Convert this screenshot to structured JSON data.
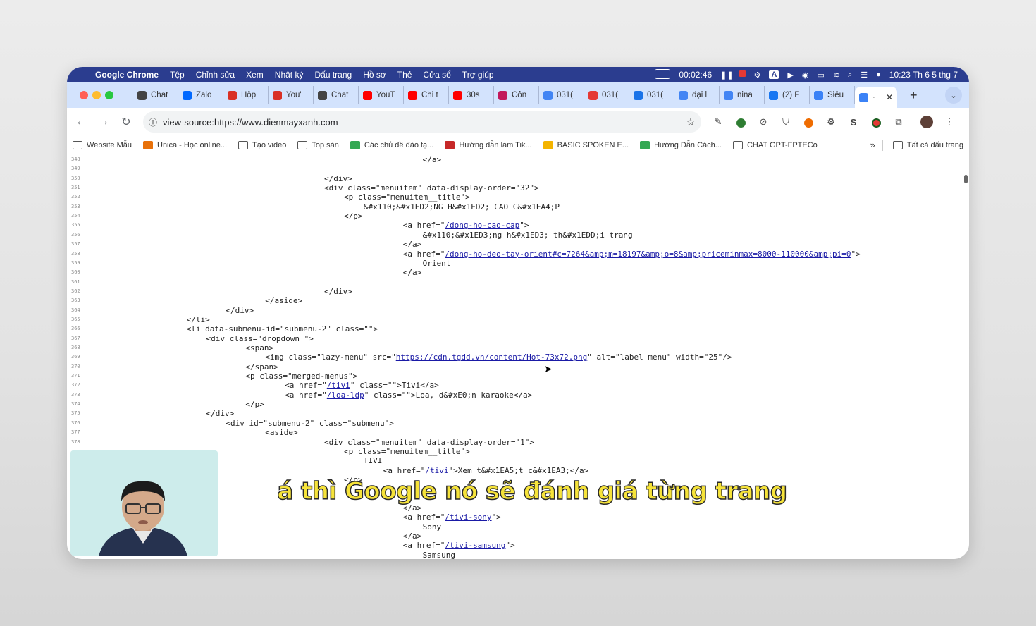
{
  "menubar": {
    "app_name": "Google Chrome",
    "menus": [
      "Tệp",
      "Chỉnh sửa",
      "Xem",
      "Nhật ký",
      "Dấu trang",
      "Hồ sơ",
      "Thẻ",
      "Cửa sổ",
      "Trợ giúp"
    ],
    "timer": "00:02:46",
    "datetime": "10:23 Th 6 5 thg 7",
    "input_source": "A"
  },
  "tabs": [
    {
      "label": "Chat",
      "icon": "chatgpt-icon",
      "color": "#444"
    },
    {
      "label": "Zalo",
      "icon": "zalo-icon",
      "color": "#0068ff"
    },
    {
      "label": "Hộp",
      "icon": "gmail-icon",
      "color": "#d93025"
    },
    {
      "label": "You'",
      "icon": "gmail-icon",
      "color": "#d93025"
    },
    {
      "label": "Chat",
      "icon": "chatgpt-icon",
      "color": "#444"
    },
    {
      "label": "YouT",
      "icon": "youtube-icon",
      "color": "#ff0000"
    },
    {
      "label": "Chi t",
      "icon": "youtube-icon",
      "color": "#ff0000"
    },
    {
      "label": "30s",
      "icon": "youtube-icon",
      "color": "#ff0000"
    },
    {
      "label": "Côn",
      "icon": "analytics-icon",
      "color": "#c2185b"
    },
    {
      "label": "031(",
      "icon": "google-icon",
      "color": "#4285f4"
    },
    {
      "label": "031(",
      "icon": "ads-icon",
      "color": "#e53935"
    },
    {
      "label": "031(",
      "icon": "sheets-icon",
      "color": "#1a73e8"
    },
    {
      "label": "đại l",
      "icon": "google-icon",
      "color": "#4285f4"
    },
    {
      "label": "nina",
      "icon": "google-icon",
      "color": "#4285f4"
    },
    {
      "label": "(2) F",
      "icon": "facebook-icon",
      "color": "#1877f2"
    },
    {
      "label": "Siêu",
      "icon": "extension-icon",
      "color": "#3b82f6"
    },
    {
      "label": "·",
      "icon": "extension-icon",
      "color": "#3b82f6",
      "active": true
    }
  ],
  "toolbar": {
    "url": "view-source:https://www.dienmayxanh.com"
  },
  "bookmarks": [
    {
      "label": "Website Mẫu",
      "icon": "folder-icon"
    },
    {
      "label": "Unica - Học online...",
      "icon": "unica-icon",
      "color": "#e8710a"
    },
    {
      "label": "Tạo video",
      "icon": "folder-icon"
    },
    {
      "label": "Top sàn",
      "icon": "folder-icon"
    },
    {
      "label": "Các chủ đề đào tạ...",
      "icon": "plus-icon",
      "color": "#34a853"
    },
    {
      "label": "Hướng dẫn làm Tik...",
      "icon": "m-icon",
      "color": "#c62828"
    },
    {
      "label": "BASIC SPOKEN E...",
      "icon": "slides-icon",
      "color": "#f4b400"
    },
    {
      "label": "Hướng Dẫn Cách...",
      "icon": "globe-icon",
      "color": "#34a853"
    },
    {
      "label": "CHAT GPT-FPTECo",
      "icon": "folder-icon"
    }
  ],
  "bookmarks_all": "Tất cả dấu trang",
  "source_lines": [
    {
      "n": "348",
      "indent": 68,
      "text": "</a>"
    },
    {
      "n": "349",
      "indent": 0,
      "text": ""
    },
    {
      "n": "350",
      "indent": 48,
      "text": "</div>"
    },
    {
      "n": "351",
      "indent": 48,
      "text": "<div class=\"menuitem\" data-display-order=\"32\">"
    },
    {
      "n": "352",
      "indent": 52,
      "text": "<p class=\"menuitem__title\">"
    },
    {
      "n": "353",
      "indent": 56,
      "text": "&#x110;&#x1ED2;NG H&#x1ED2; CAO C&#x1EA4;P"
    },
    {
      "n": "354",
      "indent": 52,
      "text": "</p>"
    },
    {
      "n": "355",
      "indent": 64,
      "pre": "<a href=\"",
      "link": "/dong-ho-cao-cap",
      "post": "\">"
    },
    {
      "n": "356",
      "indent": 68,
      "text": "&#x110;&#x1ED3;ng h&#x1ED3; th&#x1EDD;i trang"
    },
    {
      "n": "357",
      "indent": 64,
      "text": "</a>"
    },
    {
      "n": "358",
      "indent": 64,
      "pre": "<a href=\"",
      "link": "/dong-ho-deo-tay-orient#c=7264&amp;m=18197&amp;o=8&amp;priceminmax=8000-110000&amp;pi=0",
      "post": "\">"
    },
    {
      "n": "359",
      "indent": 68,
      "text": "Orient"
    },
    {
      "n": "360",
      "indent": 64,
      "text": "</a>"
    },
    {
      "n": "361",
      "indent": 0,
      "text": ""
    },
    {
      "n": "362",
      "indent": 48,
      "text": "</div>"
    },
    {
      "n": "363",
      "indent": 36,
      "text": "</aside>"
    },
    {
      "n": "364",
      "indent": 28,
      "text": "</div>"
    },
    {
      "n": "365",
      "indent": 20,
      "text": "</li>"
    },
    {
      "n": "366",
      "indent": 20,
      "text": "<li data-submenu-id=\"submenu-2\" class=\"\">"
    },
    {
      "n": "367",
      "indent": 24,
      "text": "<div class=\"dropdown \">"
    },
    {
      "n": "368",
      "indent": 32,
      "text": "<span>"
    },
    {
      "n": "369",
      "indent": 36,
      "pre": "<img class=\"lazy-menu\" src=\"",
      "link": "https://cdn.tgdd.vn/content/Hot-73x72.png",
      "post": "\" alt=\"label menu\" width=\"25\"/>"
    },
    {
      "n": "370",
      "indent": 32,
      "text": "</span>"
    },
    {
      "n": "371",
      "indent": 32,
      "text": "<p class=\"merged-menus\">"
    },
    {
      "n": "372",
      "indent": 40,
      "pre": "<a href=\"",
      "link": "/tivi",
      "post": "\" class=\"\">Tivi</a>"
    },
    {
      "n": "373",
      "indent": 40,
      "pre": "<a href=\"",
      "link": "/loa-ldp",
      "post": "\" class=\"\">Loa, d&#xE0;n karaoke</a>"
    },
    {
      "n": "374",
      "indent": 32,
      "text": "</p>"
    },
    {
      "n": "375",
      "indent": 24,
      "text": "</div>"
    },
    {
      "n": "376",
      "indent": 28,
      "text": "<div id=\"submenu-2\" class=\"submenu\">"
    },
    {
      "n": "377",
      "indent": 36,
      "text": "<aside>"
    },
    {
      "n": "378",
      "indent": 48,
      "text": "<div class=\"menuitem\" data-display-order=\"1\">"
    },
    {
      "n": "",
      "indent": 52,
      "text": "<p class=\"menuitem__title\">"
    },
    {
      "n": "",
      "indent": 56,
      "text": "TIVI"
    },
    {
      "n": "",
      "indent": 60,
      "pre": "<a href=\"",
      "link": "/tivi",
      "post": "\">Xem t&#x1EA5;t c&#x1EA3;</a>"
    },
    {
      "n": "",
      "indent": 52,
      "text": "</p>"
    },
    {
      "n": "",
      "indent": 0,
      "text": ""
    },
    {
      "n": "",
      "indent": 0,
      "text": ""
    },
    {
      "n": "",
      "indent": 64,
      "text": "</a>"
    },
    {
      "n": "",
      "indent": 64,
      "pre": "<a href=\"",
      "link": "/tivi-sony",
      "post": "\">"
    },
    {
      "n": "",
      "indent": 68,
      "text": "Sony"
    },
    {
      "n": "",
      "indent": 64,
      "text": "</a>"
    },
    {
      "n": "",
      "indent": 64,
      "pre": "<a href=\"",
      "link": "/tivi-samsung",
      "post": "\">"
    },
    {
      "n": "",
      "indent": 68,
      "text": "Samsung"
    }
  ],
  "subtitle": "á thì Google nó sẽ đánh giá từng trang"
}
